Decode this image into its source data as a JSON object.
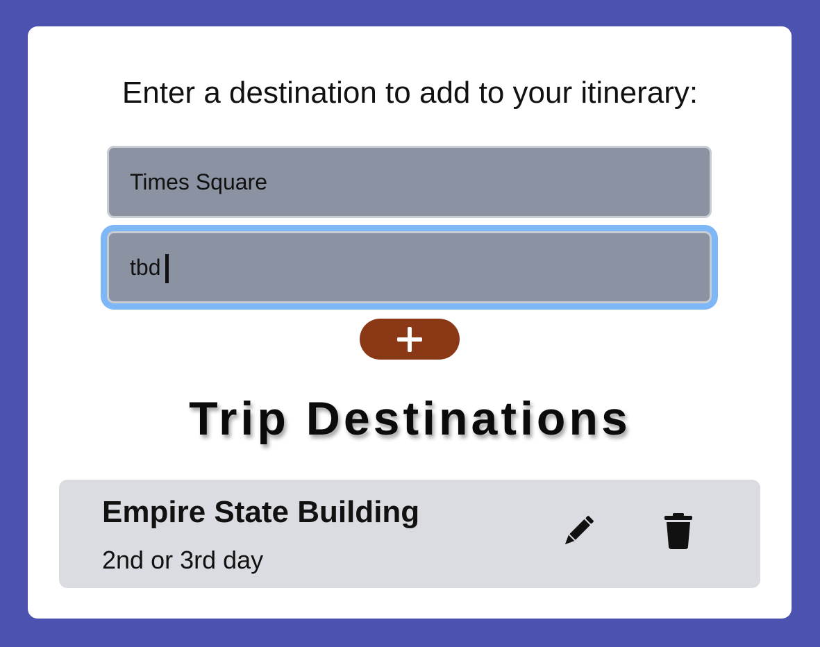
{
  "form": {
    "prompt": "Enter a destination to add to your itinerary:",
    "destination_value": "Times Square",
    "note_value": "tbd",
    "add_button_icon": "plus-icon"
  },
  "list": {
    "heading": "Trip Destinations",
    "items": [
      {
        "title": "Empire State Building",
        "note": "2nd or 3rd day",
        "edit_icon": "pencil-icon",
        "delete_icon": "trash-icon"
      }
    ]
  },
  "colors": {
    "background": "#4b52b0",
    "card": "#ffffff",
    "input_fill": "#8b92a1",
    "focus_ring": "#7db7f6",
    "add_button": "#8b3816",
    "list_item_bg": "#dadce1"
  }
}
